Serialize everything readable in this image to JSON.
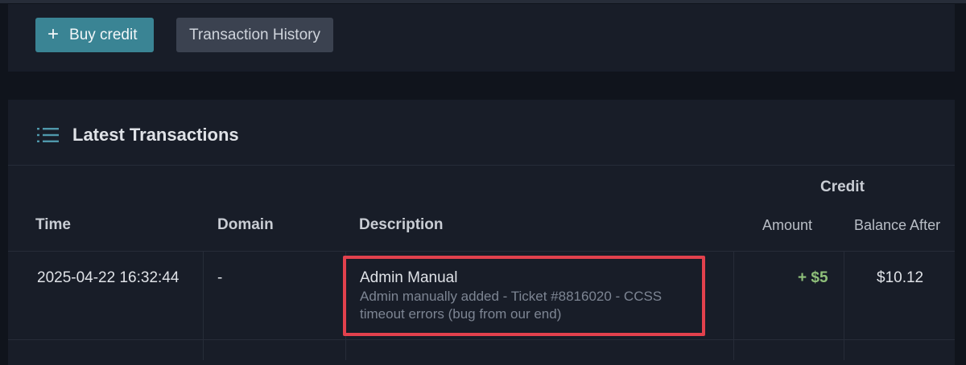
{
  "toolbar": {
    "buy_credit_icon": "+",
    "buy_credit_label": "Buy credit",
    "transaction_history_label": "Transaction History"
  },
  "transactions_panel": {
    "title": "Latest Transactions",
    "icon": "list-icon",
    "columns": {
      "time": "Time",
      "domain": "Domain",
      "description": "Description",
      "credit_group": "Credit",
      "amount": "Amount",
      "balance_after": "Balance After"
    },
    "rows": [
      {
        "time": "2025-04-22 16:32:44",
        "domain": "-",
        "description_title": "Admin Manual",
        "description_detail": "Admin manually added - Ticket #8816020 - CCSS timeout errors (bug from our end)",
        "amount": "+ $5",
        "balance_after": "$10.12"
      }
    ]
  },
  "colors": {
    "background": "#10141c",
    "panel": "#181d28",
    "primary_button": "#3a8494",
    "secondary_button": "#3b4250",
    "positive_amount": "#8fc07a",
    "highlight_border": "#e2414d"
  }
}
